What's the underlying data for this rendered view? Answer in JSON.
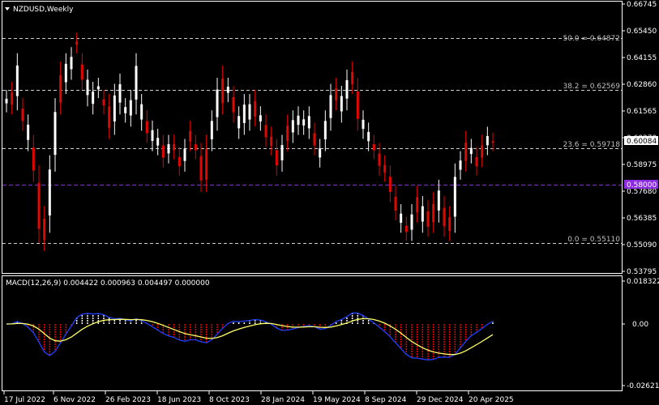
{
  "window": {
    "symbol_title": "NZDUSD,Weekly"
  },
  "colors": {
    "bg": "#000000",
    "bull": "#ffffff",
    "bear": "#e10600",
    "grid": "#cfcfcf",
    "level_line": "#8a2be2",
    "signal": "#ffff66",
    "macd_line": "#1f3fff",
    "axis": "#ffffff"
  },
  "price_scale": {
    "ticks": [
      "0.66745",
      "0.65450",
      "0.64155",
      "0.62860",
      "0.61565",
      "0.60270",
      "0.58975",
      "0.57680",
      "0.56385",
      "0.55090",
      "0.53795"
    ],
    "current_price": "0.60084",
    "marked_price": "0.58000"
  },
  "fibo_levels": [
    {
      "label": "50.0 = 0.64872",
      "value": 0.64872
    },
    {
      "label": "38.2 = 0.62569",
      "value": 0.62569
    },
    {
      "label": "23.6 = 0.59718",
      "value": 0.59718
    },
    {
      "label": "0.0 = 0.55110",
      "value": 0.5511
    }
  ],
  "horizontal_line": {
    "value": 0.58
  },
  "macd": {
    "title": "MACD(12,26,9) 0.004422 0.000963 0.004497 0.000000",
    "ticks": [
      "0.018322",
      "0.00",
      "-0.026212"
    ]
  },
  "time_axis": {
    "labels": [
      "17 Jul 2022",
      "6 Nov 2022",
      "26 Feb 2023",
      "18 Jun 2023",
      "8 Oct 2023",
      "28 Jan 2024",
      "19 May 2024",
      "8 Sep 2024",
      "29 Dec 2024",
      "20 Apr 2025"
    ]
  },
  "chart_data": {
    "type": "candlestick",
    "title": "NZDUSD,Weekly",
    "ylim": [
      0.5371,
      0.6681
    ],
    "close_path": [
      [
        0.619,
        0.622
      ],
      [
        0.618,
        0.626
      ],
      [
        0.62,
        0.64
      ],
      [
        0.61,
        0.618
      ],
      [
        0.6,
        0.61
      ],
      [
        0.585,
        0.6
      ],
      [
        0.555,
        0.585
      ],
      [
        0.551,
        0.565
      ],
      [
        0.56,
        0.59
      ],
      [
        0.59,
        0.618
      ],
      [
        0.618,
        0.636
      ],
      [
        0.628,
        0.64
      ],
      [
        0.635,
        0.643
      ],
      [
        0.648,
        0.65
      ],
      [
        0.63,
        0.64
      ],
      [
        0.622,
        0.632
      ],
      [
        0.618,
        0.626
      ],
      [
        0.626,
        0.628
      ],
      [
        0.618,
        0.622
      ],
      [
        0.606,
        0.62
      ],
      [
        0.608,
        0.625
      ],
      [
        0.618,
        0.63
      ],
      [
        0.614,
        0.618
      ],
      [
        0.612,
        0.622
      ],
      [
        0.618,
        0.64
      ],
      [
        0.61,
        0.62
      ],
      [
        0.604,
        0.612
      ],
      [
        0.6,
        0.607
      ],
      [
        0.598,
        0.603
      ],
      [
        0.592,
        0.6
      ],
      [
        0.594,
        0.6
      ],
      [
        0.596,
        0.6
      ],
      [
        0.588,
        0.594
      ],
      [
        0.59,
        0.598
      ],
      [
        0.6,
        0.607
      ],
      [
        0.596,
        0.6
      ],
      [
        0.58,
        0.596
      ],
      [
        0.58,
        0.6
      ],
      [
        0.6,
        0.612
      ],
      [
        0.61,
        0.628
      ],
      [
        0.618,
        0.634
      ],
      [
        0.624,
        0.628
      ],
      [
        0.614,
        0.624
      ],
      [
        0.606,
        0.614
      ],
      [
        0.608,
        0.62
      ],
      [
        0.61,
        0.62
      ],
      [
        0.612,
        0.622
      ],
      [
        0.61,
        0.614
      ],
      [
        0.602,
        0.61
      ],
      [
        0.598,
        0.604
      ],
      [
        0.588,
        0.598
      ],
      [
        0.59,
        0.6
      ],
      [
        0.6,
        0.61
      ],
      [
        0.604,
        0.612
      ],
      [
        0.608,
        0.614
      ],
      [
        0.608,
        0.612
      ],
      [
        0.606,
        0.614
      ],
      [
        0.598,
        0.606
      ],
      [
        0.592,
        0.598
      ],
      [
        0.6,
        0.612
      ],
      [
        0.61,
        0.625
      ],
      [
        0.62,
        0.628
      ],
      [
        0.614,
        0.624
      ],
      [
        0.62,
        0.632
      ],
      [
        0.628,
        0.636
      ],
      [
        0.61,
        0.628
      ],
      [
        0.606,
        0.612
      ],
      [
        0.6,
        0.606
      ],
      [
        0.596,
        0.6
      ],
      [
        0.588,
        0.596
      ],
      [
        0.585,
        0.59
      ],
      [
        0.575,
        0.585
      ],
      [
        0.566,
        0.575
      ],
      [
        0.56,
        0.566
      ],
      [
        0.556,
        0.56
      ],
      [
        0.556,
        0.566
      ],
      [
        0.565,
        0.575
      ],
      [
        0.56,
        0.57
      ],
      [
        0.558,
        0.568
      ],
      [
        0.56,
        0.572
      ],
      [
        0.565,
        0.578
      ],
      [
        0.558,
        0.57
      ],
      [
        0.556,
        0.565
      ],
      [
        0.56,
        0.586
      ],
      [
        0.586,
        0.592
      ],
      [
        0.59,
        0.602
      ],
      [
        0.594,
        0.598
      ],
      [
        0.588,
        0.594
      ],
      [
        0.592,
        0.6
      ],
      [
        0.598,
        0.604
      ],
      [
        0.6,
        0.601
      ]
    ]
  }
}
